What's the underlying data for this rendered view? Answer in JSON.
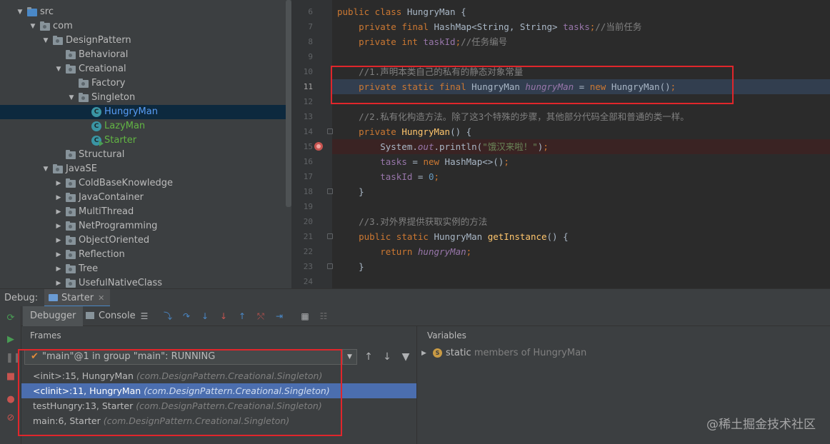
{
  "project_tree": {
    "items": [
      {
        "label": "src",
        "depth": 1,
        "kind": "source-folder",
        "expanded": true
      },
      {
        "label": "com",
        "depth": 2,
        "kind": "package",
        "expanded": true
      },
      {
        "label": "DesignPattern",
        "depth": 3,
        "kind": "package",
        "expanded": true
      },
      {
        "label": "Behavioral",
        "depth": 4,
        "kind": "package",
        "expanded": null
      },
      {
        "label": "Creational",
        "depth": 4,
        "kind": "package",
        "expanded": true
      },
      {
        "label": "Factory",
        "depth": 5,
        "kind": "package",
        "expanded": null
      },
      {
        "label": "Singleton",
        "depth": 5,
        "kind": "package",
        "expanded": true
      },
      {
        "label": "HungryMan",
        "depth": 6,
        "kind": "class",
        "selected": true,
        "color": "#589df6"
      },
      {
        "label": "LazyMan",
        "depth": 6,
        "kind": "class",
        "color": "#62b543"
      },
      {
        "label": "Starter",
        "depth": 6,
        "kind": "class-runnable",
        "color": "#62b543"
      },
      {
        "label": "Structural",
        "depth": 4,
        "kind": "package",
        "expanded": null
      },
      {
        "label": "JavaSE",
        "depth": 3,
        "kind": "package",
        "expanded": true
      },
      {
        "label": "ColdBaseKnowledge",
        "depth": 4,
        "kind": "package",
        "expanded": false
      },
      {
        "label": "JavaContainer",
        "depth": 4,
        "kind": "package",
        "expanded": false
      },
      {
        "label": "MultiThread",
        "depth": 4,
        "kind": "package",
        "expanded": false
      },
      {
        "label": "NetProgramming",
        "depth": 4,
        "kind": "package",
        "expanded": false
      },
      {
        "label": "ObjectOriented",
        "depth": 4,
        "kind": "package",
        "expanded": false
      },
      {
        "label": "Reflection",
        "depth": 4,
        "kind": "package",
        "expanded": false
      },
      {
        "label": "Tree",
        "depth": 4,
        "kind": "package",
        "expanded": false
      },
      {
        "label": "UsefulNativeClass",
        "depth": 4,
        "kind": "package",
        "expanded": false
      }
    ]
  },
  "editor": {
    "current_line": 11,
    "breakpoint_line": 15,
    "lines": [
      {
        "n": "6",
        "tokens": [
          [
            "k",
            "public class "
          ],
          [
            "p",
            "HungryMan {"
          ]
        ]
      },
      {
        "n": "7",
        "tokens": [
          [
            "p",
            "    "
          ],
          [
            "k",
            "private final "
          ],
          [
            "p",
            "HashMap<String, String> "
          ],
          [
            "fn",
            "tasks"
          ],
          [
            "k",
            ";"
          ],
          [
            "c",
            "//当前任务"
          ]
        ]
      },
      {
        "n": "8",
        "tokens": [
          [
            "p",
            "    "
          ],
          [
            "k",
            "private int "
          ],
          [
            "fn",
            "taskId"
          ],
          [
            "k",
            ";"
          ],
          [
            "c",
            "//任务编号"
          ]
        ]
      },
      {
        "n": "9",
        "tokens": []
      },
      {
        "n": "10",
        "tokens": [
          [
            "p",
            "    "
          ],
          [
            "c",
            "//1.声明本类自己的私有的静态对象常量"
          ]
        ]
      },
      {
        "n": "11",
        "tokens": [
          [
            "p",
            "    "
          ],
          [
            "k",
            "private static final "
          ],
          [
            "p",
            "HungryMan "
          ],
          [
            "f",
            "hungryMan"
          ],
          [
            "p",
            " = "
          ],
          [
            "k",
            "new "
          ],
          [
            "p",
            "HungryMan()"
          ],
          [
            "k",
            ";"
          ]
        ]
      },
      {
        "n": "12",
        "tokens": []
      },
      {
        "n": "13",
        "tokens": [
          [
            "p",
            "    "
          ],
          [
            "c",
            "//2.私有化构造方法。除了这3个特殊的步骤，其他部分代码全部和普通的类一样。"
          ]
        ]
      },
      {
        "n": "14",
        "tokens": [
          [
            "p",
            "    "
          ],
          [
            "k",
            "private "
          ],
          [
            "m",
            "HungryMan"
          ],
          [
            "p",
            "() {"
          ]
        ]
      },
      {
        "n": "15",
        "tokens": [
          [
            "p",
            "        System."
          ],
          [
            "f",
            "out"
          ],
          [
            "p",
            ".println("
          ],
          [
            "s",
            "\"饿汉来啦！\""
          ],
          [
            "p",
            ")"
          ],
          [
            "k",
            ";"
          ]
        ]
      },
      {
        "n": "16",
        "tokens": [
          [
            "p",
            "        "
          ],
          [
            "fn",
            "tasks"
          ],
          [
            "p",
            " = "
          ],
          [
            "k",
            "new "
          ],
          [
            "p",
            "HashMap<>()"
          ],
          [
            "k",
            ";"
          ]
        ]
      },
      {
        "n": "17",
        "tokens": [
          [
            "p",
            "        "
          ],
          [
            "fn",
            "taskId"
          ],
          [
            "p",
            " = "
          ],
          [
            "n",
            "0"
          ],
          [
            "k",
            ";"
          ]
        ]
      },
      {
        "n": "18",
        "tokens": [
          [
            "p",
            "    }"
          ]
        ]
      },
      {
        "n": "19",
        "tokens": []
      },
      {
        "n": "20",
        "tokens": [
          [
            "p",
            "    "
          ],
          [
            "c",
            "//3.对外界提供获取实例的方法"
          ]
        ]
      },
      {
        "n": "21",
        "tokens": [
          [
            "p",
            "    "
          ],
          [
            "k",
            "public static "
          ],
          [
            "p",
            "HungryMan "
          ],
          [
            "m",
            "getInstance"
          ],
          [
            "p",
            "() {"
          ]
        ]
      },
      {
        "n": "22",
        "tokens": [
          [
            "p",
            "        "
          ],
          [
            "k",
            "return "
          ],
          [
            "f",
            "hungryMan"
          ],
          [
            "k",
            ";"
          ]
        ]
      },
      {
        "n": "23",
        "tokens": [
          [
            "p",
            "    }"
          ]
        ]
      },
      {
        "n": "24",
        "tokens": []
      }
    ]
  },
  "debug": {
    "label": "Debug:",
    "session_tab": "Starter",
    "tabs": [
      "Debugger",
      "Console"
    ],
    "frames_title": "Frames",
    "variables_title": "Variables",
    "thread": "\"main\"@1 in group \"main\": RUNNING",
    "frames": [
      {
        "method": "<init>:15, HungryMan",
        "pkg": "(com.DesignPattern.Creational.Singleton)",
        "selected": false
      },
      {
        "method": "<clinit>:11, HungryMan",
        "pkg": "(com.DesignPattern.Creational.Singleton)",
        "selected": true
      },
      {
        "method": "testHungry:13, Starter",
        "pkg": "(com.DesignPattern.Creational.Singleton)",
        "selected": false
      },
      {
        "method": "main:6, Starter",
        "pkg": "(com.DesignPattern.Creational.Singleton)",
        "selected": false
      }
    ],
    "variable": {
      "keyword": "static",
      "desc": " members of HungryMan",
      "badge": "S"
    }
  },
  "watermark": "@稀土掘金技术社区",
  "colors": {
    "selection": "#4b6eaf",
    "annotation": "#e0262b",
    "breakpoint": "#c75450"
  }
}
